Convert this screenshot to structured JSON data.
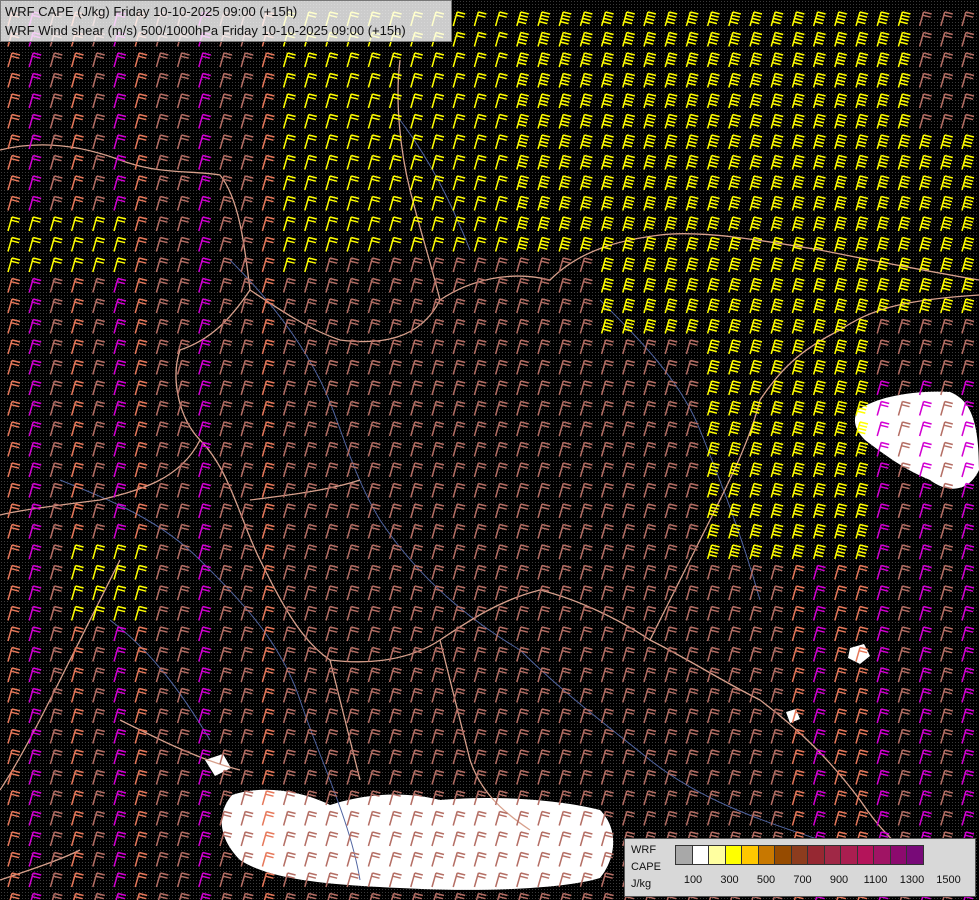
{
  "header": {
    "line1": "WRF CAPE (J/kg) Friday 10-10-2025 09:00 (+15h)",
    "line2": "WRF Wind shear (m/s) 500/1000hPa Friday 10-10-2025 09:00 (+15h)"
  },
  "legend": {
    "title_lines": [
      "WRF",
      "CAPE",
      "J/kg"
    ],
    "colors": [
      "#a8a8a8",
      "#ffffff",
      "#ffffa0",
      "#ffff00",
      "#ffc800",
      "#c87800",
      "#964b00",
      "#8c3c1e",
      "#962832",
      "#a02846",
      "#aa1e50",
      "#b4145a",
      "#a01464",
      "#8c0a6e",
      "#780a78"
    ],
    "tick_labels": [
      "100",
      "300",
      "500",
      "700",
      "900",
      "1100",
      "1300",
      "1500"
    ]
  },
  "colors": {
    "background": "#000000",
    "borders": "#d7a08c",
    "rivers": "#5064a0",
    "cloud": "#ffffff",
    "barb_yellow": "#ffff00",
    "barb_magenta": "#d200d2",
    "barb_salmon": "#e6785a",
    "barb_brown": "#b46e64"
  }
}
